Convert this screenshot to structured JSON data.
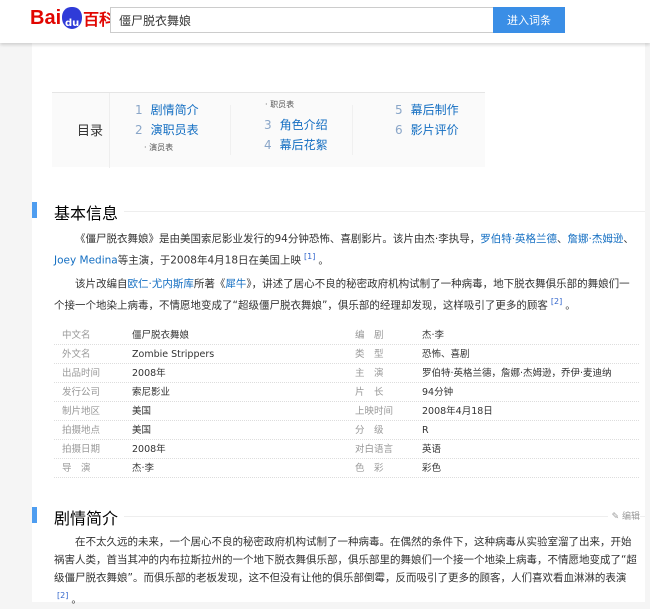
{
  "header": {
    "logo_text": "Bai",
    "logo_paw": "du",
    "logo_suffix": "百科",
    "search_value": "僵尸脱衣舞娘",
    "search_button": "进入词条"
  },
  "toc": {
    "title": "目录",
    "items": [
      {
        "num": "1",
        "label": "剧情简介"
      },
      {
        "num": "2",
        "label": "演职员表"
      },
      {
        "sub": "演员表"
      },
      {
        "sub": "职员表"
      },
      {
        "num": "3",
        "label": "角色介绍"
      },
      {
        "num": "4",
        "label": "幕后花絮"
      },
      {
        "num": "5",
        "label": "幕后制作"
      },
      {
        "num": "6",
        "label": "影片评价"
      }
    ]
  },
  "basic": {
    "heading": "基本信息",
    "p1_a": "《僵尸脱衣舞娘》是由美国索尼影业发行的94分钟恐怖、喜剧影片。该片由杰·李执导，",
    "p1_link1": "罗伯特·英格兰德",
    "p1_sep": "、",
    "p1_link2": "詹娜·杰姆逊",
    "p1_sep2": "、",
    "p1_link3": "Joey Medina",
    "p1_b": "等主演，于2008年4月18日在美国上映",
    "p1_ref": "[1]",
    "p1_end": "。",
    "p2_a": "该片改编自",
    "p2_link1": "欧仁·尤内斯库",
    "p2_b": "所著《",
    "p2_link2": "犀牛",
    "p2_c": "》，讲述了居心不良的秘密政府机构试制了一种病毒，地下脱衣舞俱乐部的舞娘们一个接一个地染上病毒，不情愿地变成了“超级僵尸脱衣舞娘”，俱乐部的经理却发现，这样吸引了更多的顾客",
    "p2_ref": "[2]",
    "p2_end": "。",
    "rows": [
      {
        "l1": "中文名",
        "v1": "僵尸脱衣舞娘",
        "l2": "编　剧",
        "v2": "杰·李"
      },
      {
        "l1": "外文名",
        "v1": "Zombie Strippers",
        "l2": "类　型",
        "v2": "恐怖、喜剧"
      },
      {
        "l1": "出品时间",
        "v1": "2008年",
        "l2": "主　演",
        "v2": "罗伯特·英格兰德，詹娜·杰姆逊，乔伊·麦迪纳"
      },
      {
        "l1": "发行公司",
        "v1": "索尼影业",
        "l2": "片　长",
        "v2": "94分钟"
      },
      {
        "l1": "制片地区",
        "v1": "美国",
        "l2": "上映时间",
        "v2": "2008年4月18日"
      },
      {
        "l1": "拍摄地点",
        "v1": "美国",
        "l2": "分　级",
        "v2": "R"
      },
      {
        "l1": "拍摄日期",
        "v1": "2008年",
        "l2": "对白语言",
        "v2": "英语"
      },
      {
        "l1": "导　演",
        "v1": "杰·李",
        "l2": "色　彩",
        "v2": "彩色"
      }
    ]
  },
  "plot": {
    "heading": "剧情简介",
    "edit": "编辑",
    "text": "在不太久远的未来，一个居心不良的秘密政府机构试制了一种病毒。在偶然的条件下，这种病毒从实验室溜了出来，开始祸害人类，首当其冲的内布拉斯拉州的一个地下脱衣舞俱乐部，俱乐部里的舞娘们一个接一个地染上病毒，不情愿地变成了“超级僵尸脱衣舞娘”。而俱乐部的老板发现，这不但没有让他的俱乐部倒霉，反而吸引了更多的顾客，人们喜欢看血淋淋的表演",
    "ref": "[2]",
    "end": "。"
  }
}
